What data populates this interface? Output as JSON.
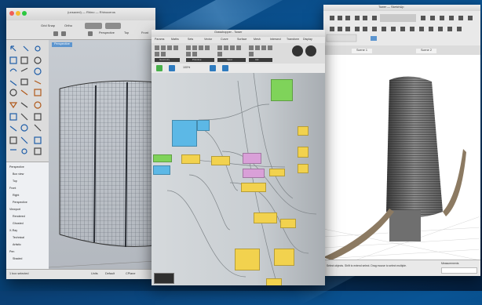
{
  "colors": {
    "accent": "#2f7fd0",
    "node_yellow": "#f2d24e",
    "node_blue": "#5cb8e6",
    "node_pink": "#d9a0d8",
    "node_green": "#7fd35a",
    "sash": "#5c95cf"
  },
  "rhino": {
    "title": "(unsaved) — Rhino — Rhinoceros",
    "toolbar": {
      "grid_snap": "Grid Snap",
      "ortho": "Ortho",
      "planar": "Planar",
      "osnap": "Osnap"
    },
    "viewport_tabs": [
      "Perspective",
      "Top",
      "Front"
    ],
    "viewport_label": "Perspective",
    "layers": [
      "Perspective",
      "Box view",
      "Top",
      "Front",
      "Right",
      "Perspective",
      "Viewport",
      "Rendered",
      "Ghosted",
      "X-Ray",
      "Technical",
      "Artistic",
      "Pen",
      "Shaded"
    ],
    "status": {
      "message": "1 box selected",
      "units": "Units",
      "layer": "Default",
      "cplane": "CPlane"
    }
  },
  "grasshopper": {
    "title": "Grasshopper - Tower",
    "menu": [
      "Params",
      "Maths",
      "Sets",
      "Vector",
      "Curve",
      "Surface",
      "Mesh",
      "Intersect",
      "Transform",
      "Display"
    ],
    "ribbon_groups": [
      "Geometry",
      "Primitive",
      "Input",
      "Util"
    ],
    "zoom": "100%"
  },
  "sketchup": {
    "title": "Tower — SketchUp",
    "tabs": [
      "Scene 1",
      "Scene 2"
    ],
    "status": "Select objects. Shift to extend select. Drag mouse to select multiple.",
    "measurements_label": "Measurements"
  }
}
